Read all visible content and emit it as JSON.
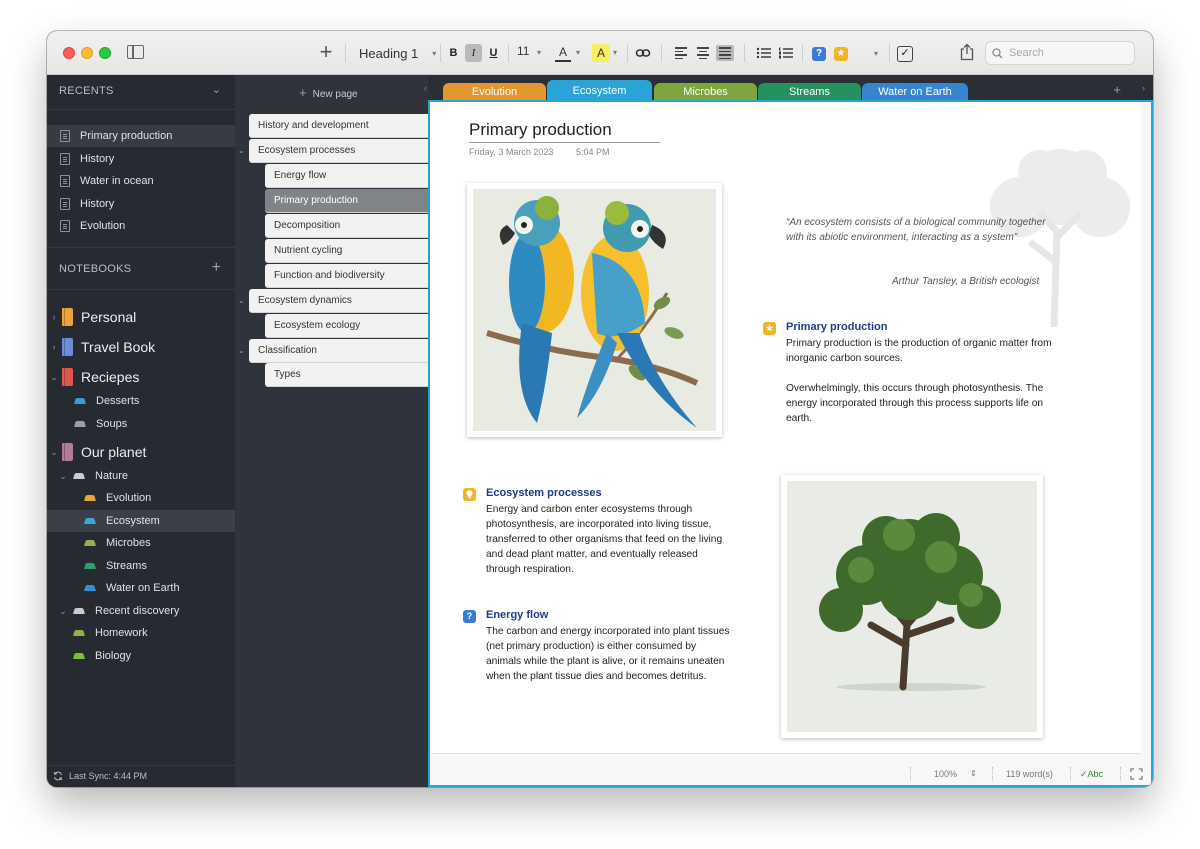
{
  "toolbar": {
    "style": "Heading 1",
    "bold": "B",
    "italic": "I",
    "underline": "U",
    "font_size": "11",
    "font_color_glyph": "A",
    "highlight_glyph": "A",
    "highlight_color": "#f7ee60",
    "checkbox_glyph": "✓",
    "search_placeholder": "Search"
  },
  "sidebar": {
    "recents_header": "RECENTS",
    "recents": [
      "Primary production",
      "History",
      "Water in ocean",
      "History",
      "Evolution"
    ],
    "notebooks_header": "NOTEBOOKS",
    "notebooks": [
      {
        "label": "Personal",
        "color": "#f0a23a"
      },
      {
        "label": "Travel Book",
        "color": "#6a8fd8"
      },
      {
        "label": "Reciepes",
        "color": "#e2574c"
      },
      {
        "label": "Our planet",
        "color": "#b07a98"
      }
    ],
    "recipe_sections": [
      {
        "label": "Desserts",
        "color": "#3b9ad9"
      },
      {
        "label": "Soups",
        "color": "#9aa0aa"
      }
    ],
    "nature_group": "Nature",
    "nature_sections": [
      {
        "label": "Evolution",
        "color": "#e8a33d"
      },
      {
        "label": "Ecosystem",
        "color": "#38a7dc"
      },
      {
        "label": "Microbes",
        "color": "#8fb34a"
      },
      {
        "label": "Streams",
        "color": "#2e9f6b"
      },
      {
        "label": "Water on Earth",
        "color": "#3b8fd6"
      }
    ],
    "discovery_group": "Recent discovery",
    "discovery_sections": [
      {
        "label": "Homework",
        "color": "#8fb34a"
      },
      {
        "label": "Biology",
        "color": "#7bbf3a"
      }
    ],
    "sync": "Last Sync: 4:44 PM"
  },
  "pages": {
    "new_page": "New page",
    "items": [
      "History and development",
      "Ecosystem processes",
      "Energy flow",
      "Primary production",
      "Decomposition",
      "Nutrient cycling",
      "Function and biodiversity",
      "Ecosystem dynamics",
      "Ecosystem ecology",
      "Classification",
      "Types"
    ]
  },
  "tabs": [
    {
      "label": "Evolution",
      "color": "#e4962f"
    },
    {
      "label": "Ecosystem",
      "color": "#2aa3d6"
    },
    {
      "label": "Microbes",
      "color": "#7fa63c"
    },
    {
      "label": "Streams",
      "color": "#23925e"
    },
    {
      "label": "Water on Earth",
      "color": "#3586cf"
    }
  ],
  "page": {
    "title": "Primary production",
    "date": "Friday, 3 March 2023",
    "time": "5:04 PM",
    "quote": "“An ecosystem consists of a biological community together with its abiotic environment, interacting as a system”",
    "quote_author": "Arthur Tansley, a British ecologist",
    "notes": [
      {
        "title": "Primary production",
        "tag": "star",
        "tag_color": "#f0b429",
        "body1": "Primary production is the production of organic matter from inorganic carbon sources.",
        "body2": "Overwhelmingly, this occurs through photosynthesis. The energy incorporated through this process supports life on earth."
      },
      {
        "title": "Ecosystem processes",
        "tag": "lightbulb",
        "tag_color": "#f0b429",
        "body1": "Energy and carbon enter ecosystems through photosynthesis, are incorporated into living tissue, transferred to other organisms that feed on the living and dead plant matter, and eventually released through respiration."
      },
      {
        "title": "Energy flow",
        "tag": "question",
        "tag_color": "#3a7bd5",
        "body1": "The carbon and energy incorporated into plant tissues (net primary production) is either consumed by animals while the plant is alive, or it remains uneaten when the plant tissue dies and becomes detritus."
      }
    ]
  },
  "status": {
    "zoom": "100%",
    "words": "119 word(s)",
    "spell": "✓Abc"
  }
}
